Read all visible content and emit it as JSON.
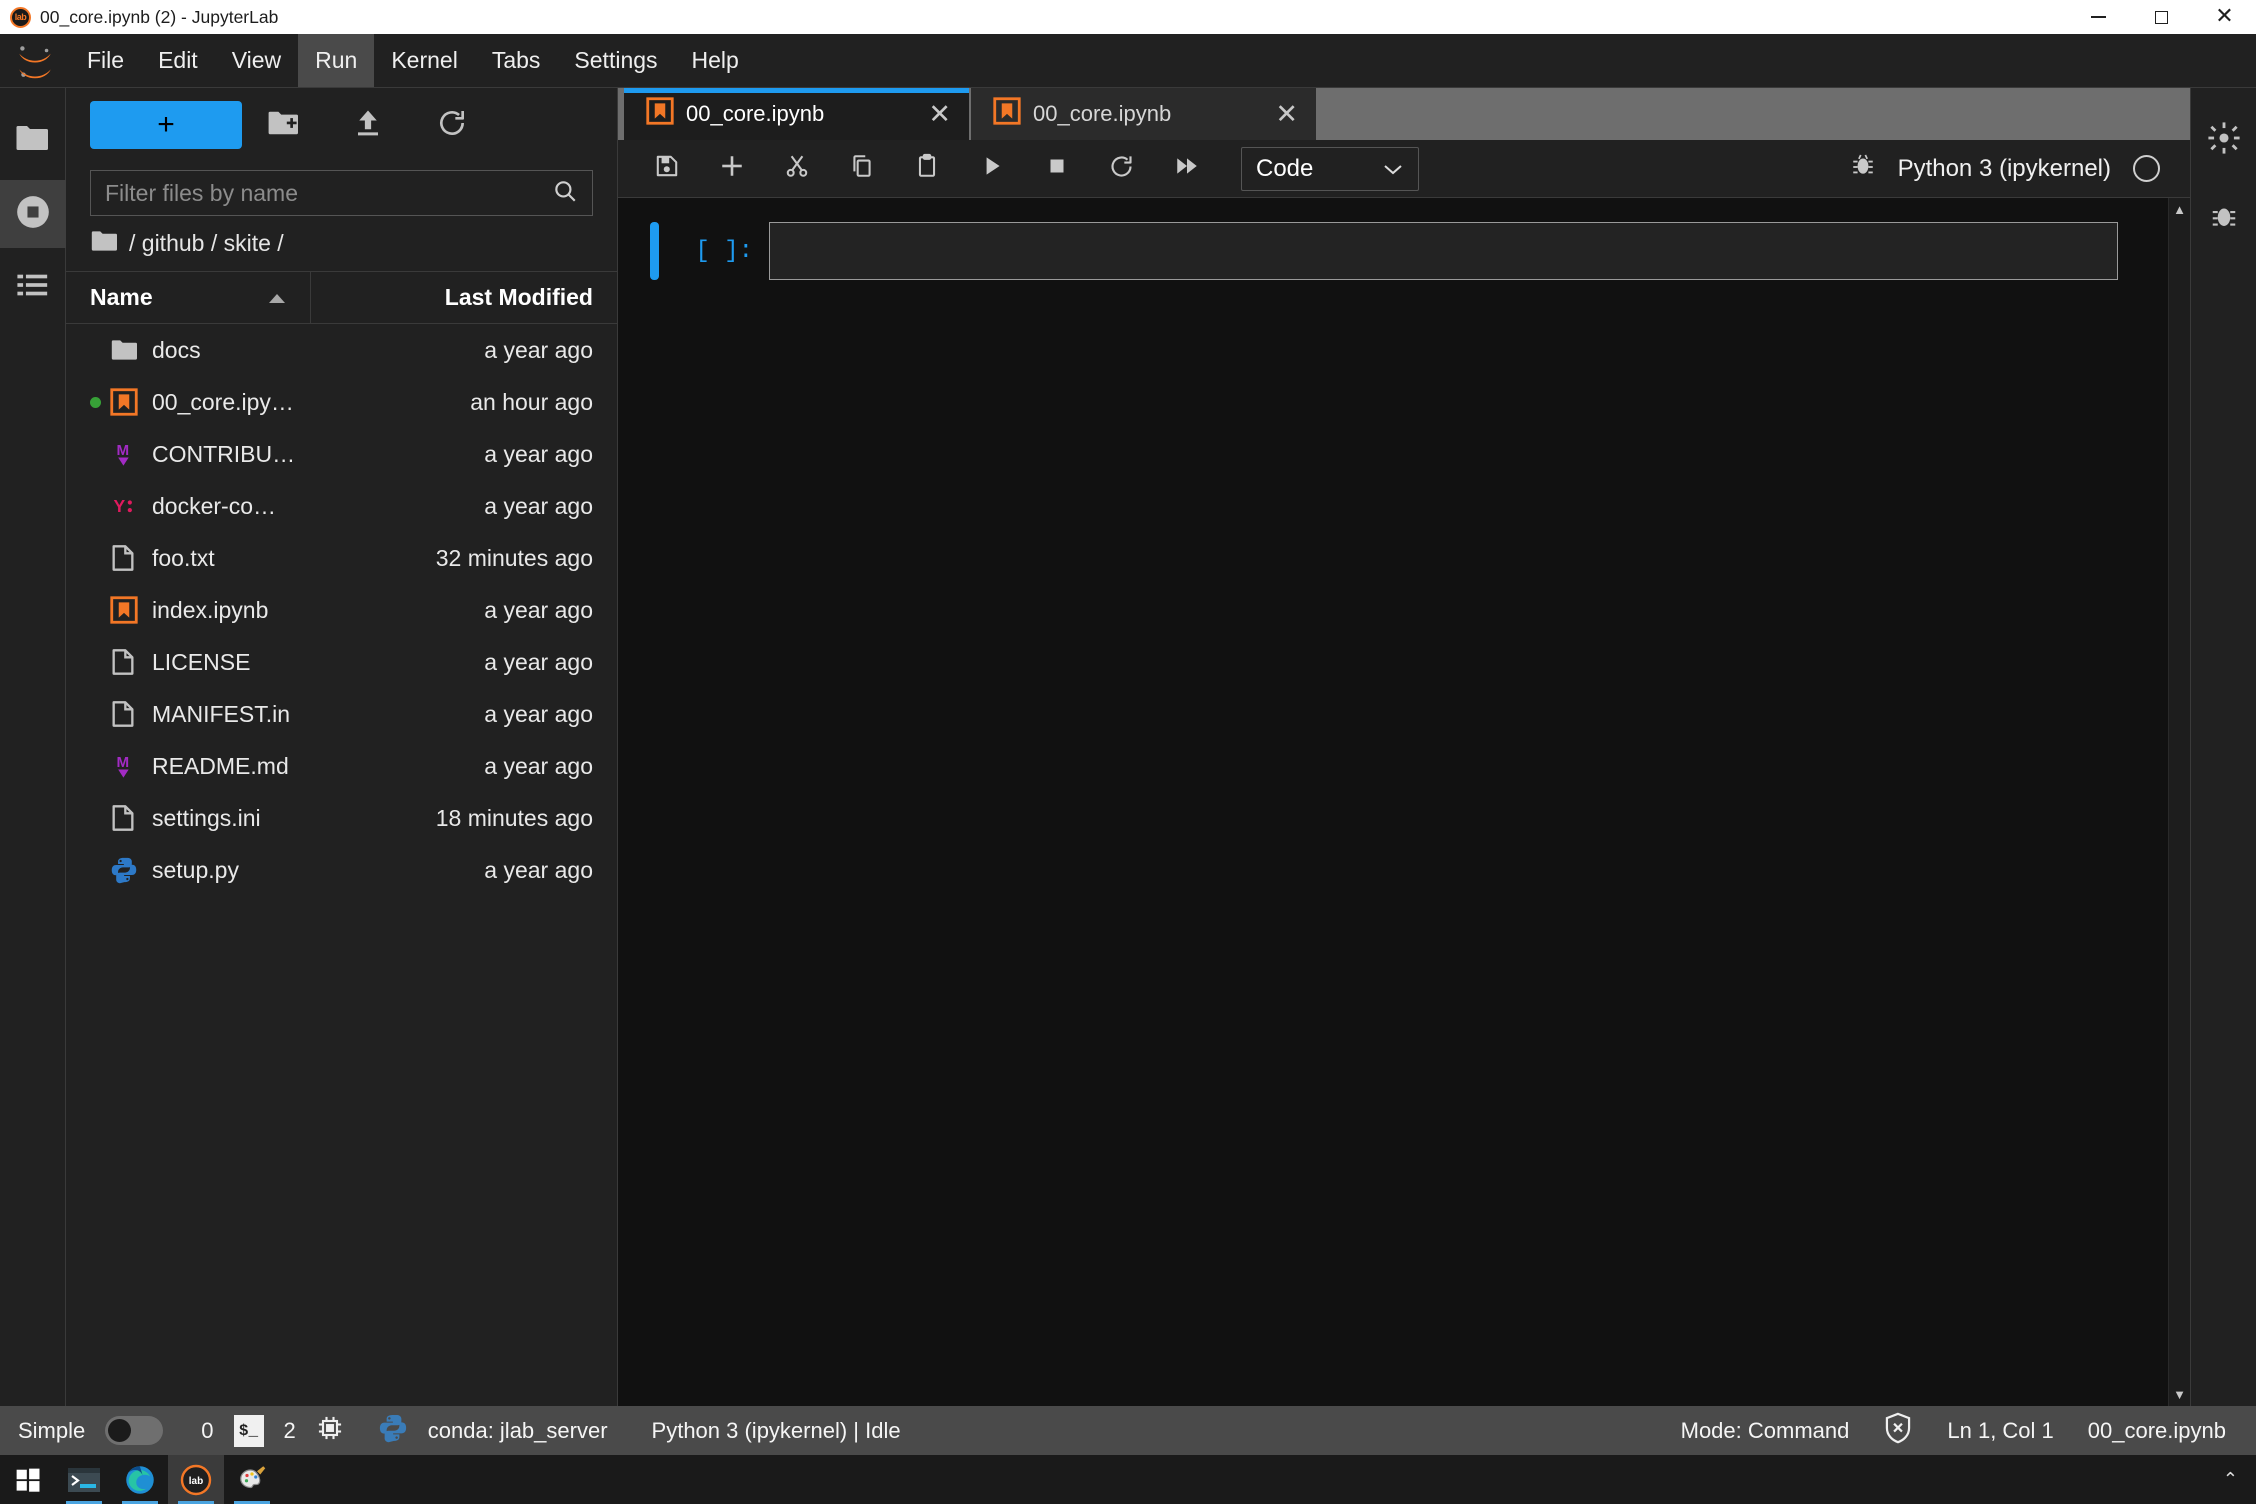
{
  "window": {
    "title": "00_core.ipynb (2) - JupyterLab",
    "favicon_label": "lab",
    "minimize_icon": "minimize-icon",
    "maximize_icon": "maximize-icon",
    "close_icon": "close-icon"
  },
  "menubar": {
    "logo": "jupyter-logo",
    "items": [
      {
        "label": "File",
        "active": false
      },
      {
        "label": "Edit",
        "active": false
      },
      {
        "label": "View",
        "active": false
      },
      {
        "label": "Run",
        "active": true
      },
      {
        "label": "Kernel",
        "active": false
      },
      {
        "label": "Tabs",
        "active": false
      },
      {
        "label": "Settings",
        "active": false
      },
      {
        "label": "Help",
        "active": false
      }
    ]
  },
  "left_activity_bar": {
    "items": [
      {
        "name": "file-browser-icon",
        "selected": false
      },
      {
        "name": "running-terminals-icon",
        "selected": true
      },
      {
        "name": "table-of-contents-icon",
        "selected": false
      }
    ]
  },
  "right_activity_bar": {
    "items": [
      {
        "name": "property-inspector-icon"
      },
      {
        "name": "debugger-icon"
      }
    ]
  },
  "filebrowser": {
    "new_launcher_label": "+",
    "new_folder_icon": "new-folder-icon",
    "upload_icon": "upload-icon",
    "refresh_icon": "refresh-icon",
    "filter": {
      "placeholder": "Filter files by name",
      "value": "",
      "search_icon": "search-icon"
    },
    "breadcrumb": "/ github / skite /",
    "columns": {
      "name": "Name",
      "last_modified": "Last Modified",
      "sort_icon": "sort-ascending-icon"
    },
    "files": [
      {
        "name": "docs",
        "modified": "a year ago",
        "icon": "folder-icon",
        "running": false
      },
      {
        "name": "00_core.ipy…",
        "modified": "an hour ago",
        "icon": "notebook-icon",
        "running": true
      },
      {
        "name": "CONTRIBU…",
        "modified": "a year ago",
        "icon": "markdown-icon",
        "running": false
      },
      {
        "name": "docker-co…",
        "modified": "a year ago",
        "icon": "yaml-icon",
        "running": false
      },
      {
        "name": "foo.txt",
        "modified": "32 minutes ago",
        "icon": "file-icon",
        "running": false
      },
      {
        "name": "index.ipynb",
        "modified": "a year ago",
        "icon": "notebook-icon",
        "running": false
      },
      {
        "name": "LICENSE",
        "modified": "a year ago",
        "icon": "file-icon",
        "running": false
      },
      {
        "name": "MANIFEST.in",
        "modified": "a year ago",
        "icon": "file-icon",
        "running": false
      },
      {
        "name": "README.md",
        "modified": "a year ago",
        "icon": "markdown-icon",
        "running": false
      },
      {
        "name": "settings.ini",
        "modified": "18 minutes ago",
        "icon": "file-icon",
        "running": false
      },
      {
        "name": "setup.py",
        "modified": "a year ago",
        "icon": "python-icon",
        "running": false
      }
    ]
  },
  "dock": {
    "tabs": [
      {
        "label": "00_core.ipynb",
        "icon": "notebook-icon",
        "active": true,
        "close_icon": "close-icon"
      },
      {
        "label": "00_core.ipynb",
        "icon": "notebook-icon",
        "active": false,
        "close_icon": "close-icon"
      }
    ],
    "toolbar": {
      "buttons": [
        {
          "name": "save-button",
          "icon": "save-icon"
        },
        {
          "name": "insert-cell-button",
          "icon": "plus-icon"
        },
        {
          "name": "cut-button",
          "icon": "scissors-icon"
        },
        {
          "name": "copy-button",
          "icon": "copy-icon"
        },
        {
          "name": "paste-button",
          "icon": "paste-icon"
        },
        {
          "name": "run-button",
          "icon": "play-icon"
        },
        {
          "name": "interrupt-button",
          "icon": "stop-icon"
        },
        {
          "name": "restart-button",
          "icon": "restart-icon"
        },
        {
          "name": "restart-run-all-button",
          "icon": "fast-forward-icon"
        }
      ],
      "cell_type": {
        "value": "Code",
        "chevron": "chevron-down-icon"
      },
      "debugger_icon": "bug-icon",
      "kernel_name": "Python 3 (ipykernel)",
      "kernel_status": "idle"
    },
    "notebook": {
      "cells": [
        {
          "prompt": "[ ]:",
          "source": "",
          "selected": true
        }
      ]
    }
  },
  "statusbar": {
    "simple_label": "Simple",
    "simple_on": false,
    "terminals_count": "0",
    "terminal_icon": "terminal-icon",
    "kernels_count": "2",
    "kernel_icon": "cpu-chip-icon",
    "python_icon": "python-icon",
    "conda_env": "conda: jlab_server",
    "kernel_status": "Python 3 (ipykernel) | Idle",
    "mode": "Mode: Command",
    "trust_icon": "untrusted-shield-icon",
    "cursor_position": "Ln 1, Col 1",
    "active_file": "00_core.ipynb"
  },
  "taskbar": {
    "items": [
      {
        "name": "start-button-icon",
        "active": false,
        "running": false
      },
      {
        "name": "terminal-icon",
        "active": false,
        "running": true
      },
      {
        "name": "edge-browser-icon",
        "active": false,
        "running": true
      },
      {
        "name": "jupyterlab-icon",
        "active": true,
        "running": true
      },
      {
        "name": "paint-icon",
        "active": false,
        "running": true
      }
    ],
    "show_hidden_icon": "chevron-up-icon"
  }
}
